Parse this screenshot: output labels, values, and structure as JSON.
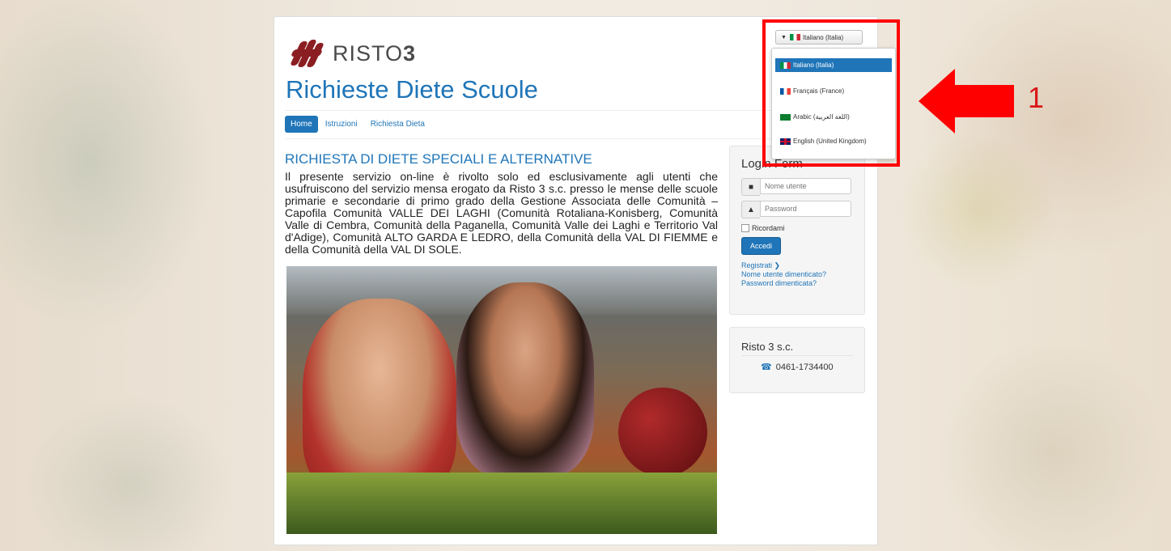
{
  "header": {
    "logo_text": "RISTO",
    "logo_number": "3",
    "site_title": "Richieste Diete Scuole"
  },
  "nav": {
    "items": [
      "Home",
      "Istruzioni",
      "Richiesta Dieta"
    ]
  },
  "article": {
    "title": "RICHIESTA DI DIETE SPECIALI E ALTERNATIVE",
    "body": "Il presente servizio on-line è rivolto solo ed esclusivamente agli utenti che usufruiscono del servizio mensa erogato da Risto 3 s.c. presso le mense delle scuole primarie e secondarie di primo grado della Gestione Associata delle Comunità – Capofila Comunità VALLE DEI LAGHI (Comunità Rotaliana-Konisberg, Comunità Valle di Cembra, Comunità della Paganella, Comunità Valle dei Laghi e Territorio Val d'Adige), Comunità ALTO GARDA E LEDRO, della Comunità della VAL DI FIEMME e della Comunità della VAL DI SOLE."
  },
  "login": {
    "title": "Login Form",
    "username_placeholder": "Nome utente",
    "password_placeholder": "Password",
    "remember_label": "Ricordami",
    "submit_label": "Accedi",
    "register_link": "Registrati",
    "forgot_username": "Nome utente dimenticato?",
    "forgot_password": "Password dimenticata?"
  },
  "contact": {
    "title": "Risto 3 s.c.",
    "phone": "0461-1734400"
  },
  "language": {
    "selected": "Italiano (Italia)",
    "options": [
      {
        "label": "Italiano (Italia)",
        "flag": "it"
      },
      {
        "label": "Français (France)",
        "flag": "fr"
      },
      {
        "label": "Arabic (اللغة العربية)",
        "flag": "ar"
      },
      {
        "label": "English (United Kingdom)",
        "flag": "gb"
      }
    ]
  },
  "annotation": {
    "number": "1",
    "color": "#ff0000"
  },
  "colors": {
    "brand_blue": "#1f75b8",
    "logo_red": "#8b1e22"
  }
}
